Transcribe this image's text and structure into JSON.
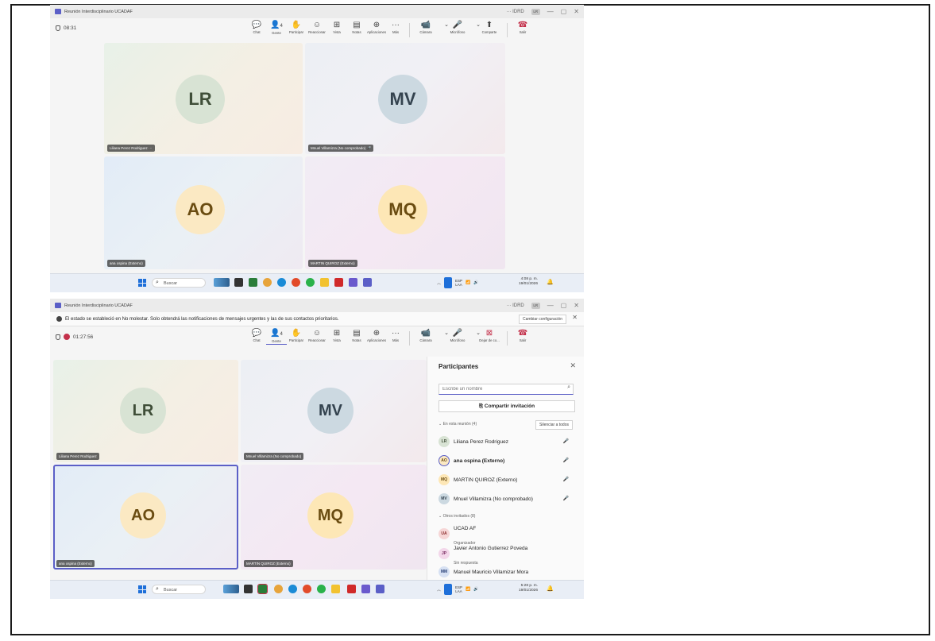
{
  "screen1": {
    "window_title": "Reunión Interdisciplinario UCADAF",
    "title_right": "··· IDRD",
    "user_initials": "LR",
    "timer": "08:31",
    "toolbar": {
      "chat": "Chat",
      "people": "Gente",
      "people_count": "4",
      "raise": "Participar",
      "react": "Reaccionar",
      "view": "Vista",
      "notes": "Notas",
      "apps": "Aplicaciones",
      "more": "Más",
      "camera": "Cámara",
      "mic": "Micrófono",
      "share": "Comparte",
      "leave": "Salir"
    },
    "tiles": [
      {
        "initials": "LR",
        "name": "Liliana Perez Rodriguez",
        "extra": "···"
      },
      {
        "initials": "MV",
        "name": "Mnuel Villamizra (No comprobado)",
        "extra": "🎤"
      },
      {
        "initials": "AO",
        "name": "ana ospina (Externo)",
        "extra": ""
      },
      {
        "initials": "MQ",
        "name": "MARTIN QUIROZ (Externo)",
        "extra": ""
      }
    ],
    "taskbar": {
      "search": "Buscar",
      "lang1": "ESP",
      "lang2": "LAA",
      "time": "4:08 p. m.",
      "date": "19/01/2026"
    }
  },
  "screen2": {
    "window_title": "Reunión Interdisciplinario UCADAF",
    "title_right": "··· IDRD",
    "user_initials": "LR",
    "notification": "El estado se estableció en No molestar. Solo obtendrá las notificaciones de mensajes urgentes y las de sus contactos prioritarios.",
    "notification_button": "Cambiar configuración",
    "timer": "01:27:56",
    "toolbar": {
      "chat": "Chat",
      "people": "Gente",
      "people_count": "4",
      "raise": "Participar",
      "react": "Reaccionar",
      "view": "Vista",
      "notes": "Notas",
      "apps": "Aplicaciones",
      "more": "Más",
      "camera": "Cámara",
      "mic": "Micrófono",
      "share": "Dejar de co...",
      "leave": "Salir"
    },
    "tiles": [
      {
        "initials": "LR",
        "name": "Liliana Perez Rodriguez"
      },
      {
        "initials": "MV",
        "name": "Mnuel Villamizra (No comprobado)"
      },
      {
        "initials": "AO",
        "name": "ana ospina (Externo)"
      },
      {
        "initials": "MQ",
        "name": "MARTIN QUIROZ (Externo)"
      }
    ],
    "panel": {
      "title": "Participantes",
      "search_placeholder": "Escribe un nombre",
      "invite": "Compartir invitación",
      "in_meeting": "En esta reunión (4)",
      "mute_all": "Silenciar a todos",
      "participants": [
        {
          "initials": "LR",
          "name": "Liliana Perez Rodriguez"
        },
        {
          "initials": "AO",
          "name": "ana ospina (Externo)"
        },
        {
          "initials": "MQ",
          "name": "MARTIN QUIROZ (Externo)"
        },
        {
          "initials": "MV",
          "name": "Mnuel Villamizra (No comprobado)"
        }
      ],
      "others": "Otros invitados (8)",
      "invitees": [
        {
          "initials": "UA",
          "name": "UCAD AF",
          "sub": "Organizador"
        },
        {
          "initials": "JP",
          "name": "Javier Antonio Gutierrez Poveda",
          "sub": "Sin respuesta"
        },
        {
          "initials": "MM",
          "name": "Manuel Mauricio Villamizar Mora",
          "sub": ""
        }
      ]
    },
    "taskbar": {
      "search": "Buscar",
      "lang1": "ESP",
      "lang2": "LAA",
      "time": "5:28 p. m.",
      "date": "19/01/2026"
    }
  },
  "colors": {
    "accent": "#5b5fc7",
    "leave": "#c4314b",
    "taskbar": "#e9eef6"
  }
}
